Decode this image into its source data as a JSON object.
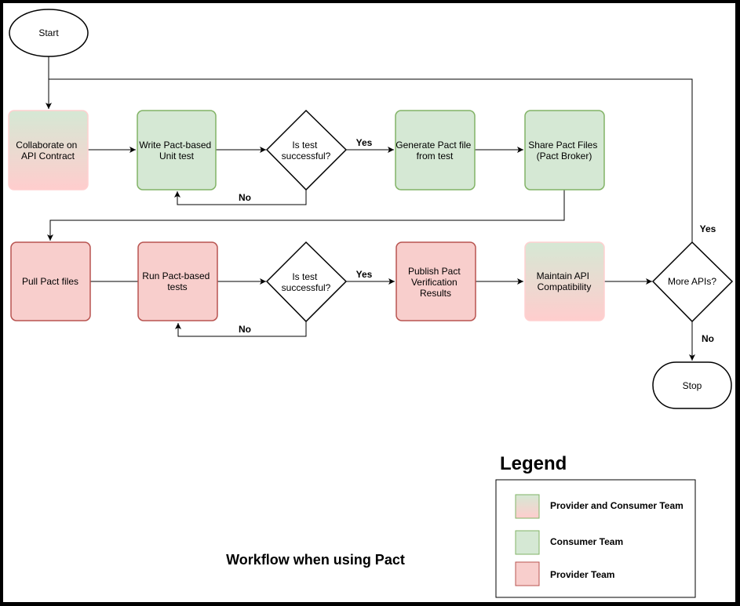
{
  "title": "Workflow when using Pact",
  "colors": {
    "consumer_fill": "#d5e8d4",
    "consumer_stroke": "#82b366",
    "provider_fill": "#f8cecc",
    "provider_stroke": "#b85450",
    "both_fill_top": "#d5e8d4",
    "both_fill_bottom": "#ffcdcd",
    "both_stroke": "#ffd0d0"
  },
  "nodes": {
    "start": {
      "label": "Start",
      "type": "terminal"
    },
    "collaborate": {
      "label_lines": [
        "Collaborate on",
        "API Contract"
      ],
      "team": "both"
    },
    "write_test": {
      "label_lines": [
        "Write Pact-based",
        "Unit test"
      ],
      "team": "consumer"
    },
    "decision_consumer": {
      "label_lines": [
        "Is test",
        "successful?"
      ],
      "type": "decision"
    },
    "generate_file": {
      "label_lines": [
        "Generate Pact file",
        "from test"
      ],
      "team": "consumer"
    },
    "share_files": {
      "label_lines": [
        "Share Pact Files",
        "(Pact Broker)"
      ],
      "team": "consumer"
    },
    "pull_files": {
      "label_lines": [
        "Pull Pact files"
      ],
      "team": "provider"
    },
    "run_tests": {
      "label_lines": [
        "Run Pact-based",
        "tests"
      ],
      "team": "provider"
    },
    "decision_provider": {
      "label_lines": [
        "Is test",
        "successful?"
      ],
      "type": "decision"
    },
    "publish_results": {
      "label_lines": [
        "Publish Pact",
        "Verification",
        "Results"
      ],
      "team": "provider"
    },
    "maintain": {
      "label_lines": [
        "Maintain API",
        "Compatibility"
      ],
      "team": "both"
    },
    "more_apis": {
      "label_lines": [
        "More APIs?"
      ],
      "type": "decision"
    },
    "stop": {
      "label": "Stop",
      "type": "terminal"
    }
  },
  "edge_labels": {
    "yes_consumer": "Yes",
    "no_consumer": "No",
    "yes_provider": "Yes",
    "no_provider": "No",
    "yes_more": "Yes",
    "no_more": "No"
  },
  "legend": {
    "title": "Legend",
    "items": [
      {
        "label": "Provider and Consumer Team",
        "team": "both"
      },
      {
        "label": "Consumer Team",
        "team": "consumer"
      },
      {
        "label": "Provider Team",
        "team": "provider"
      }
    ]
  }
}
